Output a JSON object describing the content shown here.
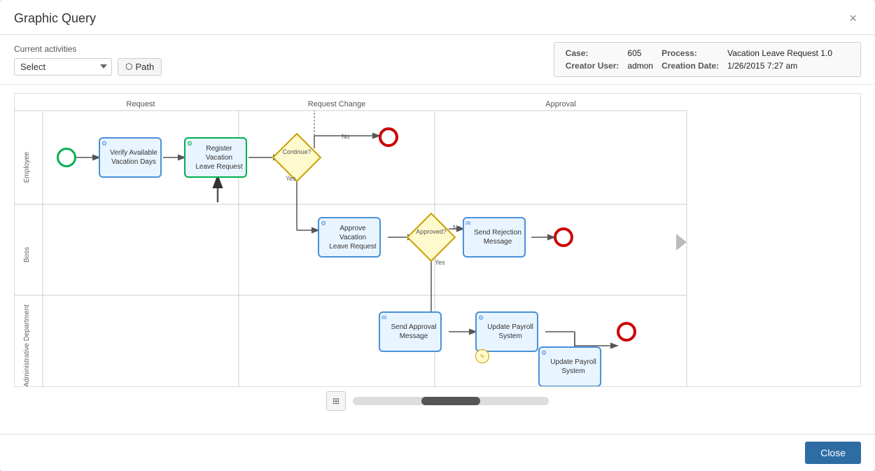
{
  "dialog": {
    "title": "Graphic Query",
    "close_label": "×"
  },
  "toolbar": {
    "current_activities_label": "Current activities",
    "select_placeholder": "Select",
    "select_options": [
      "Select"
    ],
    "path_button_label": "Path"
  },
  "info_panel": {
    "case_label": "Case:",
    "case_value": "605",
    "process_label": "Process:",
    "process_value": "Vacation Leave Request 1.0",
    "creator_label": "Creator User:",
    "creator_value": "admon",
    "creation_date_label": "Creation Date:",
    "creation_date_value": "1/26/2015 7:27 am"
  },
  "swimlanes": [
    {
      "label": "Employee"
    },
    {
      "label": "Boss"
    },
    {
      "label": "Administrative Department"
    }
  ],
  "columns": [
    {
      "label": "Request"
    },
    {
      "label": "Request Change"
    },
    {
      "label": "Approval"
    }
  ],
  "nodes": {
    "start": {
      "label": ""
    },
    "verify_vacation": {
      "label": "Verify Available Vacation Days"
    },
    "register_vacation": {
      "label": "Register Vacation Leave Request"
    },
    "gateway_continue": {
      "label": "Continue?"
    },
    "end1": {
      "label": ""
    },
    "approve_vacation": {
      "label": "Approve Vacation Leave Request"
    },
    "gateway_approved": {
      "label": "Approved?"
    },
    "send_rejection": {
      "label": "Send Rejection Message"
    },
    "end2": {
      "label": ""
    },
    "send_approval": {
      "label": "Send Approval Message"
    },
    "update_payroll1": {
      "label": "Update Payroll System"
    },
    "update_payroll2": {
      "label": "Update Payroll System"
    },
    "end3": {
      "label": ""
    }
  },
  "labels": {
    "no": "No",
    "yes": "Yes",
    "yes2": "Yes",
    "no2": "No"
  },
  "footer": {
    "close_button": "Close"
  },
  "icons": {
    "path_icon": "⬡",
    "fit_icon": "⊞",
    "task_gear": "⚙"
  }
}
